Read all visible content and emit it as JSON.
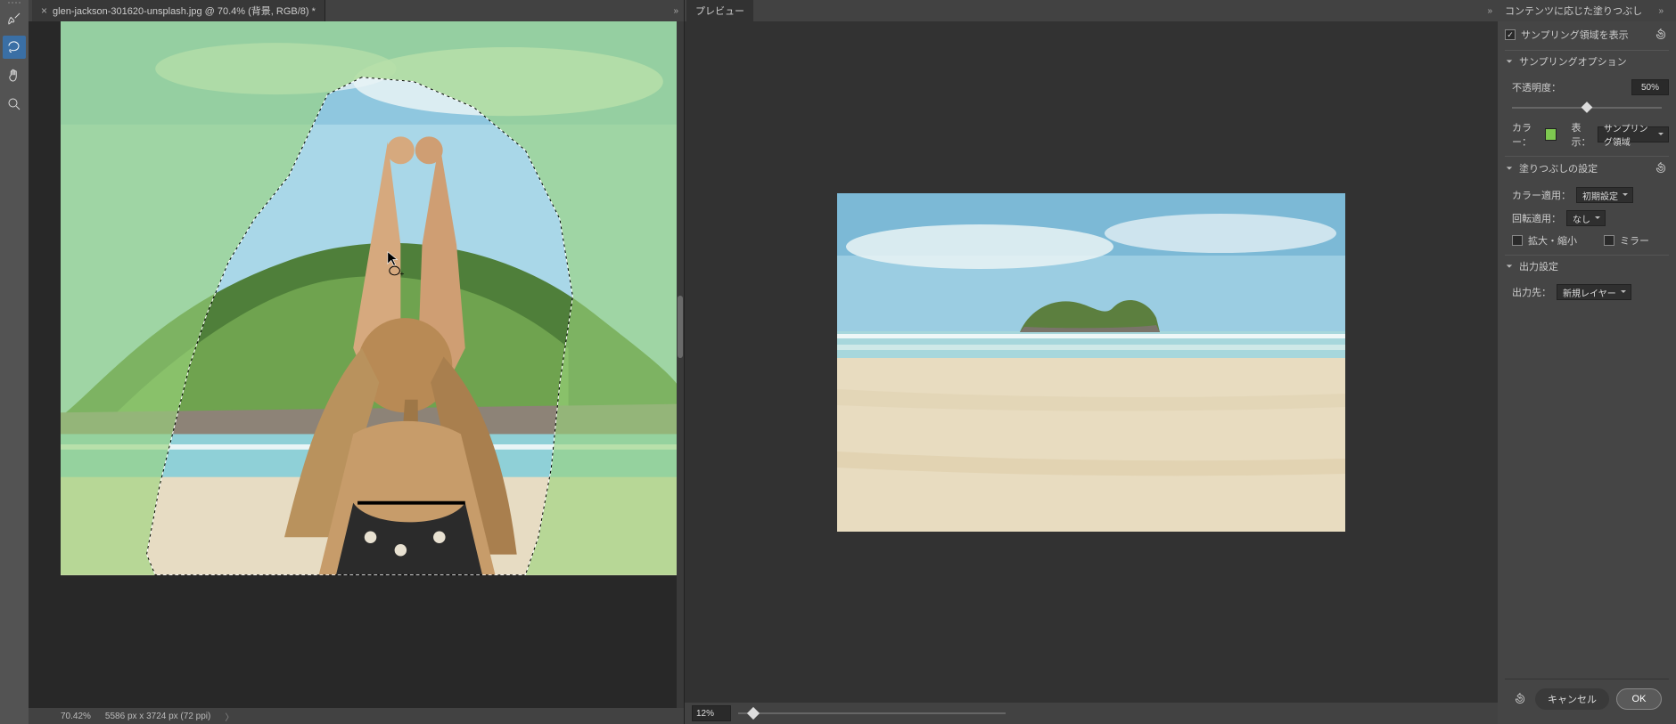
{
  "doc": {
    "tab_title": "glen-jackson-301620-unsplash.jpg @ 70.4% (背景, RGB/8) *",
    "status_zoom": "70.42%",
    "status_dims": "5586 px x 3724 px (72 ppi)"
  },
  "tools": {
    "items": [
      "brush-icon",
      "lasso-icon",
      "hand-icon",
      "zoom-icon"
    ],
    "active_index": 1
  },
  "preview": {
    "tab": "プレビュー",
    "zoom_value": "12%"
  },
  "panel": {
    "title": "コンテンツに応じた塗りつぶし",
    "show_sampling_label": "サンプリング領域を表示",
    "show_sampling_checked": true,
    "sections": {
      "sampling": "サンプリングオプション",
      "fill": "塗りつぶしの設定",
      "output": "出力設定"
    },
    "opacity_label": "不透明度：",
    "opacity_value": "50%",
    "color_label": "カラー：",
    "display_label": "表示：",
    "display_value": "サンプリング領域",
    "color_adapt_label": "カラー適用：",
    "color_adapt_value": "初期設定",
    "rotate_label": "回転適用：",
    "rotate_value": "なし",
    "scale_label": "拡大・縮小",
    "scale_checked": false,
    "mirror_label": "ミラー",
    "mirror_checked": false,
    "output_to_label": "出力先：",
    "output_to_value": "新規レイヤー",
    "buttons": {
      "cancel": "キャンセル",
      "ok": "OK"
    },
    "swatch_color": "#87cf6a"
  }
}
